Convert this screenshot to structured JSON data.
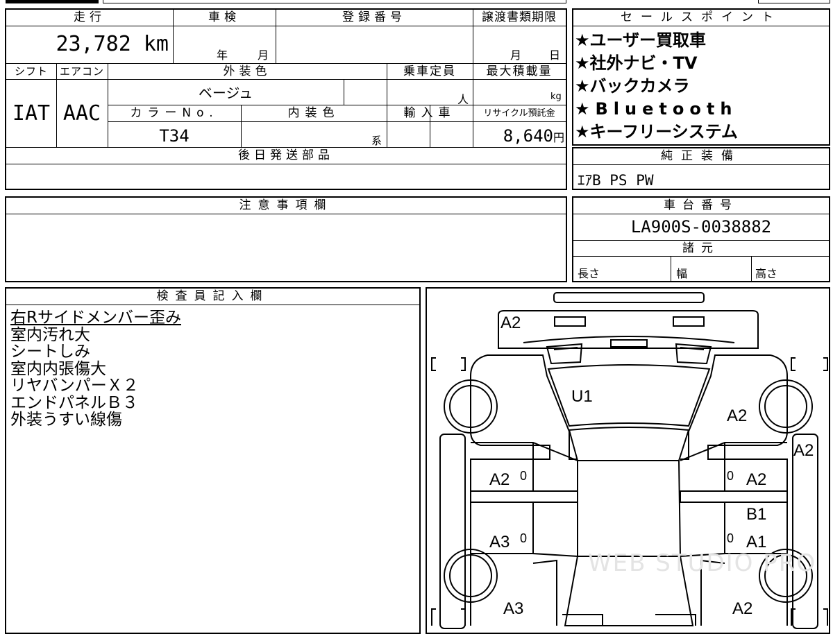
{
  "top": {
    "h_mileage": "走行",
    "mileage": "23,782 km",
    "h_shaken": "車検",
    "shaken_year": "年",
    "shaken_month": "月",
    "h_reg": "登録番号",
    "h_deadline": "譲渡書類期限",
    "deadline_month": "月",
    "deadline_day": "日",
    "h_shift": "シフト",
    "shift": "IAT",
    "h_ac": "エアコン",
    "ac": "AAC",
    "h_ext_color": "外装色",
    "ext_color": "ベージュ",
    "h_capacity": "乗車定員",
    "capacity_unit": "人",
    "h_load": "最大積載量",
    "load_unit": "kg",
    "h_color_no": "カラーNo.",
    "color_no": "T34",
    "h_int_color": "内装色",
    "int_color_suffix": "系",
    "h_import": "輸入車",
    "h_recycle": "リサイクル預託金",
    "recycle": "8,640",
    "recycle_unit": "円",
    "h_later_parts": "後日発送部品"
  },
  "sales": {
    "header": "セールスポイント",
    "items": [
      "★ユーザー買取車",
      "★社外ナビ・TV",
      "★バックカメラ",
      "★Bluetooth",
      "★キーフリーシステム"
    ]
  },
  "genuine": {
    "header": "純正装備",
    "value": "ｴｱB PS PW"
  },
  "notes": {
    "header": "注意事項欄"
  },
  "chassis": {
    "header": "車台番号",
    "value": "LA900S-0038882"
  },
  "specs": {
    "header": "諸元",
    "length": "長さ",
    "width": "幅",
    "height": "高さ"
  },
  "inspector": {
    "header": "検査員記入欄",
    "items": [
      "右Rサイドメンバー歪み",
      "室内汚れ大",
      "シートしみ",
      "室内内張傷大",
      "リヤバンパーＸ２",
      "エンドパネルＢ３",
      "外装うすい線傷"
    ]
  },
  "diagram": {
    "marks": {
      "front_bumper": "A2",
      "hood": "U1",
      "right_front_fender": "A2",
      "right_edge": "A2",
      "left_front_door": "A2",
      "left_front_door_zero": "0",
      "right_front_door": "A2",
      "right_front_door_zero": "0",
      "right_pillar": "B1",
      "left_rear_door": "A3",
      "left_rear_door_zero": "0",
      "right_rear_door": "A1",
      "right_rear_door_zero": "0",
      "left_rear_quarter": "A3",
      "right_rear_quarter": "A2"
    },
    "watermark": "WEB STUDIO PRO"
  }
}
